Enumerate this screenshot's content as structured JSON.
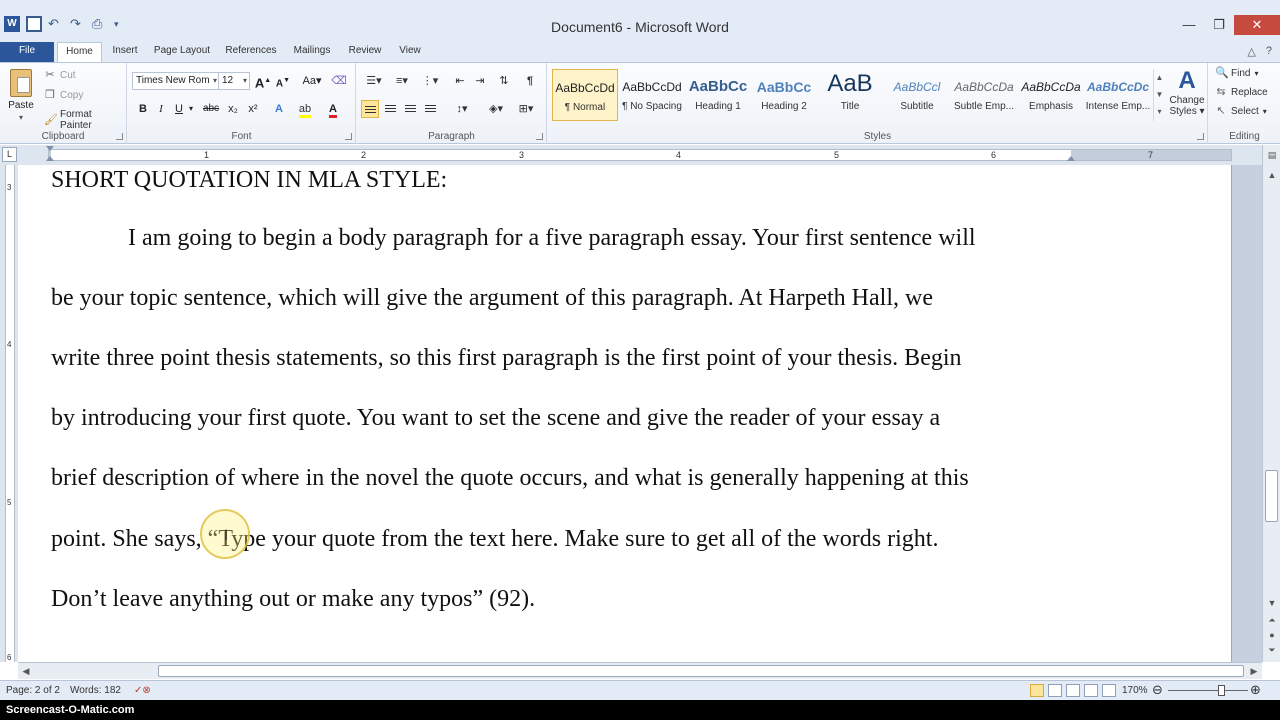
{
  "window": {
    "title": "Document6 - Microsoft Word",
    "app_icon": "word-icon",
    "qat": [
      "save-icon",
      "undo-icon",
      "redo-icon",
      "print-icon"
    ],
    "controls": [
      "minimize-icon",
      "restore-icon",
      "close-icon"
    ]
  },
  "tabs": [
    {
      "label": "File"
    },
    {
      "label": "Home"
    },
    {
      "label": "Insert"
    },
    {
      "label": "Page Layout"
    },
    {
      "label": "References"
    },
    {
      "label": "Mailings"
    },
    {
      "label": "Review"
    },
    {
      "label": "View"
    }
  ],
  "ribbon": {
    "clipboard": {
      "label": "Clipboard",
      "paste": "Paste",
      "cut": "Cut",
      "copy": "Copy",
      "format_painter": "Format Painter"
    },
    "font": {
      "label": "Font",
      "font_name": "Times New Rom",
      "font_size": "12",
      "bold": "B",
      "italic": "I",
      "underline": "U",
      "strikethrough": "abc",
      "subscript": "x₂",
      "superscript": "x²",
      "grow": "A",
      "shrink": "A",
      "case": "Aa"
    },
    "paragraph": {
      "label": "Paragraph",
      "pilcrow": "¶"
    },
    "styles": {
      "label": "Styles",
      "items": [
        {
          "sample": "AaBbCcDd",
          "name": "¶ Normal"
        },
        {
          "sample": "AaBbCcDd",
          "name": "¶ No Spacing"
        },
        {
          "sample": "AaBbCc",
          "name": "Heading 1"
        },
        {
          "sample": "AaBbCc",
          "name": "Heading 2"
        },
        {
          "sample": "AaB",
          "name": "Title"
        },
        {
          "sample": "AaBbCcl",
          "name": "Subtitle"
        },
        {
          "sample": "AaBbCcDa",
          "name": "Subtle Emp..."
        },
        {
          "sample": "AaBbCcDa",
          "name": "Emphasis"
        },
        {
          "sample": "AaBbCcDc",
          "name": "Intense Emp..."
        }
      ],
      "change_styles_line1": "Change",
      "change_styles_line2": "Styles"
    },
    "editing": {
      "label": "Editing",
      "find": "Find",
      "replace": "Replace",
      "select": "Select"
    }
  },
  "ruler": {
    "numbers": [
      "1",
      "2",
      "3",
      "4",
      "5",
      "6",
      "7"
    ],
    "vertical_numbers": [
      "3",
      "4",
      "5",
      "6"
    ]
  },
  "document": {
    "heading": "SHORT QUOTATION IN MLA STYLE:",
    "lines": [
      "I am going to begin a body paragraph for a five paragraph essay.  Your first sentence will",
      "be your topic sentence, which will give the argument of this paragraph.  At Harpeth Hall, we",
      "write three point thesis statements, so this first paragraph is the first point of your thesis.  Begin",
      "by introducing your first quote.  You want to set the scene and give the reader of your essay a",
      "brief description of where in the novel the quote occurs, and what is generally happening at this",
      "point.  She says, “Type your quote from the text here.  Make sure to get all of the words right.",
      "Don’t leave anything out or make any typos” (92)."
    ]
  },
  "status": {
    "page": "Page: 2 of 2",
    "words": "Words: 182",
    "zoom": "170%",
    "zoom_level": 1.7
  },
  "watermark": "Screencast-O-Matic.com",
  "colors": {
    "accent": "#2b579a",
    "ribbon_bg": "#e3ebf6",
    "selected_style": "#fff3c9"
  }
}
